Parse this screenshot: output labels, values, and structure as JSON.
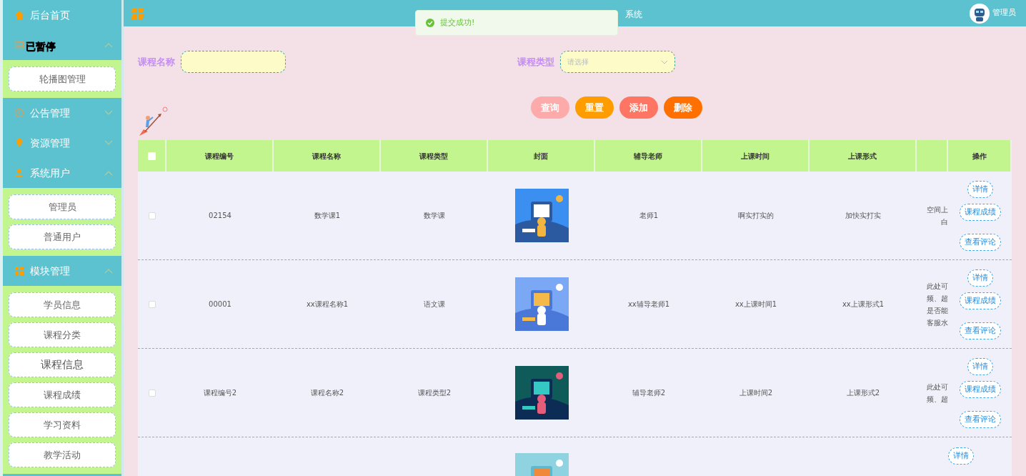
{
  "sidebar": {
    "items": [
      {
        "kind": "link",
        "label": "后台首页"
      },
      {
        "kind": "group",
        "overlay": "已暂停",
        "expanded": true,
        "children": [
          {
            "label": "轮播图管理",
            "selected": false
          }
        ]
      },
      {
        "kind": "group",
        "label": "公告管理",
        "expanded": false
      },
      {
        "kind": "group",
        "label": "资源管理",
        "expanded": false
      },
      {
        "kind": "group",
        "label": "系统用户",
        "expanded": true,
        "children": [
          {
            "label": "管理员",
            "selected": false
          },
          {
            "label": "普通用户",
            "selected": false
          }
        ]
      },
      {
        "kind": "group",
        "label": "模块管理",
        "expanded": true,
        "children": [
          {
            "label": "学员信息",
            "selected": false
          },
          {
            "label": "课程分类",
            "selected": false
          },
          {
            "label": "课程信息",
            "selected": true
          },
          {
            "label": "课程成绩",
            "selected": false
          },
          {
            "label": "学习资料",
            "selected": false
          },
          {
            "label": "教学活动",
            "selected": false
          }
        ]
      }
    ]
  },
  "header": {
    "title": "系统",
    "user": "管理员"
  },
  "toast": {
    "message": "提交成功!"
  },
  "search": {
    "fields": [
      {
        "kind": "input",
        "label": "课程名称"
      },
      {
        "kind": "select",
        "label": "课程类型",
        "placeholder": "请选择"
      }
    ],
    "buttons": [
      {
        "label": "查询",
        "color": "#fdaaaa"
      },
      {
        "label": "重置",
        "color": "#ff9d00"
      },
      {
        "label": "添加",
        "color": "#ff7563"
      },
      {
        "label": "删除",
        "color": "#ff7000"
      }
    ]
  },
  "table": {
    "select_all": {
      "checked": false
    },
    "columns": [
      "课程编号",
      "课程名称",
      "课程类型",
      "封面",
      "辅导老师",
      "上课时间",
      "上课形式"
    ],
    "actions_header": "操作",
    "rows": [
      {
        "checked": false,
        "code": "02154",
        "name": "数学课1",
        "type": "数学课",
        "cover": {
          "kind": "picture"
        },
        "teacher": "老师1",
        "time": "啊实打实的",
        "format": "加快实打实",
        "column_8": [
          "空间上",
          "白"
        ],
        "actions": [
          "详情",
          "课程成绩",
          "查看评论"
        ]
      },
      {
        "checked": false,
        "code": "00001",
        "name": "xx课程名称1",
        "type": "语文课",
        "cover": {
          "kind": "picture"
        },
        "teacher": "xx辅导老师1",
        "time": "xx上课时间1",
        "format": "xx上课形式1",
        "column_8": [
          "此处可",
          "频、超",
          "是否能",
          "客服水"
        ],
        "actions": [
          "详情",
          "课程成绩",
          "查看评论"
        ]
      },
      {
        "checked": false,
        "code": "课程编号2",
        "name": "课程名称2",
        "type": "课程类型2",
        "cover": {
          "kind": "picture"
        },
        "teacher": "辅导老师2",
        "time": "上课时间2",
        "format": "上课形式2",
        "column_8": [
          "此处可",
          "频、超"
        ],
        "actions": [
          "详情",
          "课程成绩",
          "查看评论"
        ]
      },
      {
        "cover": {
          "kind": "picture"
        },
        "actions": [
          "详情"
        ]
      }
    ]
  }
}
